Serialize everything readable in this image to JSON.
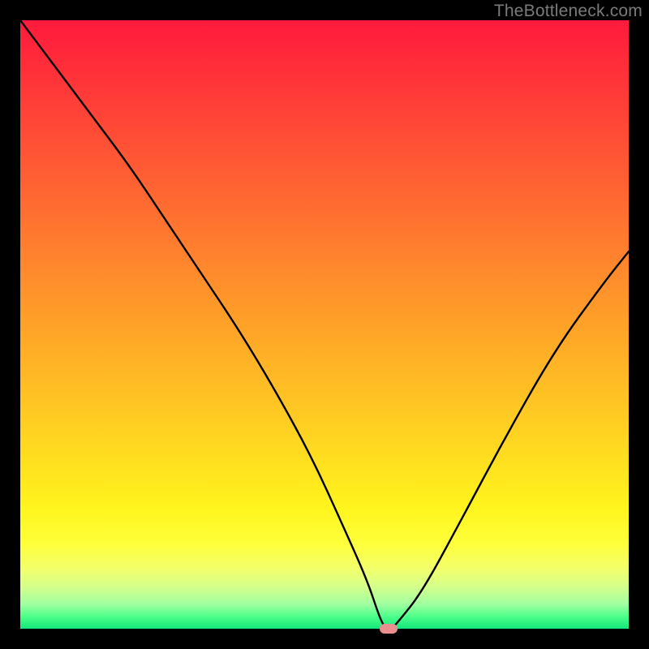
{
  "watermark": "TheBottleneck.com",
  "colors": {
    "frame": "#000000",
    "curve": "#000000",
    "marker": "#e98f8f",
    "watermark_text": "#7a7a7a",
    "gradient_top": "#ff1a3c",
    "gradient_bottom": "#14e67a"
  },
  "chart_data": {
    "type": "line",
    "title": "",
    "xlabel": "",
    "ylabel": "",
    "xlim": [
      0,
      100
    ],
    "ylim": [
      0,
      100
    ],
    "grid": false,
    "legend": false,
    "series": [
      {
        "name": "bottleneck-curve",
        "x": [
          0,
          6,
          12,
          18,
          24,
          30,
          36,
          42,
          48,
          53,
          57,
          59,
          60,
          61,
          62,
          66,
          72,
          80,
          88,
          96,
          100
        ],
        "values": [
          100,
          92,
          84,
          76,
          67,
          58,
          49,
          39,
          28,
          17,
          8,
          2,
          0,
          0,
          1,
          6,
          17,
          32,
          46,
          57,
          62
        ]
      }
    ],
    "annotation": {
      "name": "optimal-point-marker",
      "x": 60.5,
      "y": 0
    }
  }
}
